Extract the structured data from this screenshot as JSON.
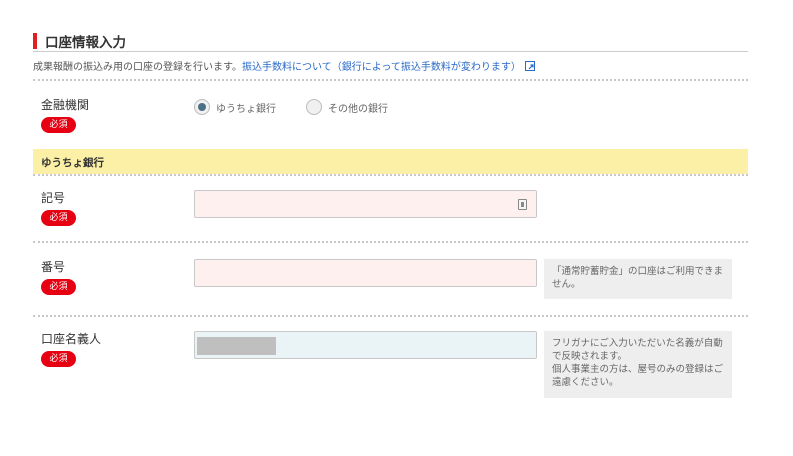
{
  "section": {
    "title": "口座情報入力",
    "description": "成果報酬の振込み用の口座の登録を行います。",
    "fee_link": "振込手数料について（銀行によって振込手数料が変わります）"
  },
  "institution": {
    "label": "金融機関",
    "required": "必須",
    "options": [
      {
        "label": "ゆうちょ銀行",
        "checked": true
      },
      {
        "label": "その他の銀行",
        "checked": false
      }
    ]
  },
  "bank_band": {
    "label": "ゆうちょ銀行"
  },
  "symbol": {
    "label": "記号",
    "required": "必須",
    "value": ""
  },
  "number": {
    "label": "番号",
    "required": "必須",
    "value": "",
    "note": "「通常貯蓄貯金」の口座はご利用できません。"
  },
  "holder": {
    "label": "口座名義人",
    "required": "必須",
    "note_line1": "フリガナにご入力いただいた名義が自動で反映されます。",
    "note_line2": "個人事業主の方は、屋号のみの登録はご遠慮ください。"
  },
  "colors": {
    "accent_red": "#e60012",
    "heading_bar": "#e02020",
    "band_yellow": "#fbf0a6",
    "link_blue": "#2a6ac8",
    "radio_checked": "#4a6f87"
  }
}
